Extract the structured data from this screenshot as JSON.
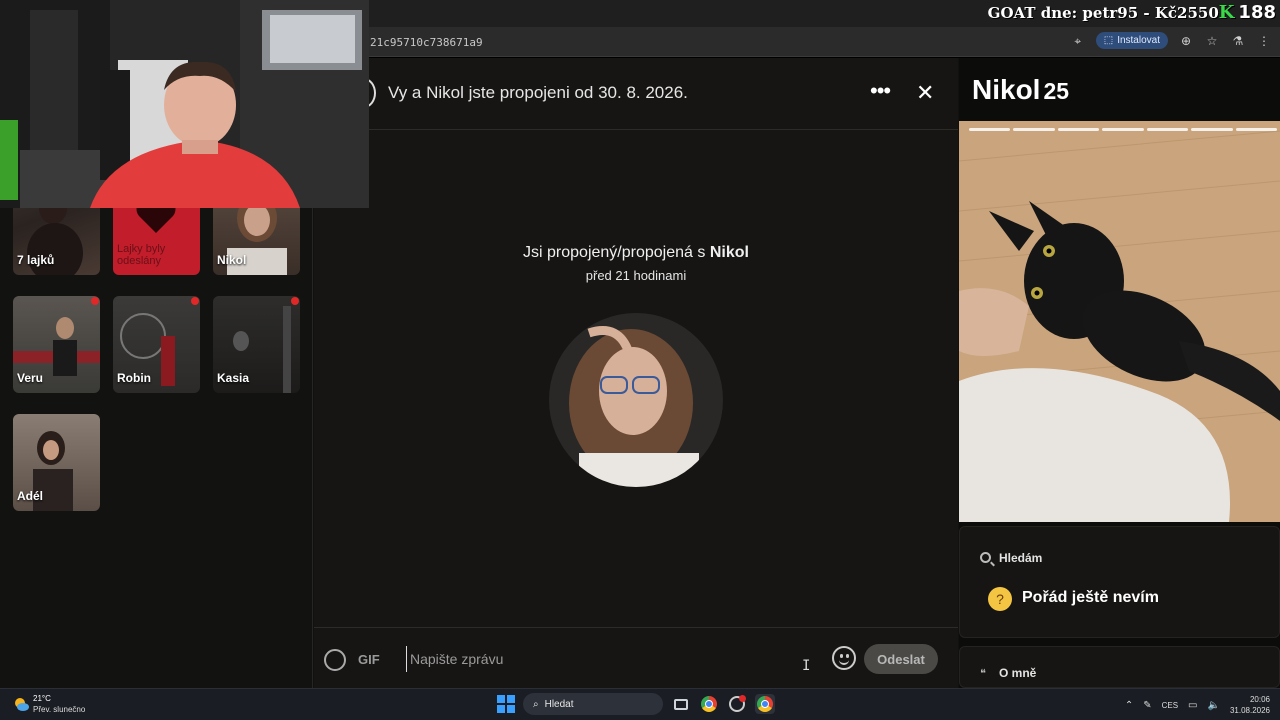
{
  "browser": {
    "goat_banner": "GOAT dne: petr95 - Kč2550",
    "goat_k": "K",
    "goat_count": "188",
    "url_fragment": "21c95710c738671a9",
    "install_label": "Instalovat"
  },
  "tiles": [
    {
      "label": "7 lajků",
      "dot": false
    },
    {
      "label": "Lajky byly odeslány",
      "dot": false
    },
    {
      "label": "Nikol",
      "dot": false
    },
    {
      "label": "Veru",
      "dot": true
    },
    {
      "label": "Robin",
      "dot": true
    },
    {
      "label": "Kasia",
      "dot": true
    },
    {
      "label": "Adél",
      "dot": false
    }
  ],
  "chat": {
    "header": "Vy a Nikol jste propojeni od 30. 8. 2026.",
    "match_prefix": "Jsi propojený/propojená s",
    "match_name": "Nikol",
    "match_time": "před 21 hodinami",
    "gif_label": "GIF",
    "input_placeholder": "Napište zprávu",
    "send_label": "Odeslat"
  },
  "profile": {
    "name": "Nikol",
    "age": "25",
    "photo_count": 7,
    "looking_for_label": "Hledám",
    "looking_for_value": "Pořád ještě nevím",
    "about_label": "O mně"
  },
  "taskbar": {
    "temp": "21°C",
    "weather": "Přev. slunečno",
    "search": "Hledat",
    "lang": "CES",
    "time": "20:06",
    "date": "31.08.2026"
  },
  "colors": {
    "app_bg": "#111110",
    "panel_bg": "#161513",
    "send_bg": "#4a4946",
    "accent_red": "#e02828"
  }
}
